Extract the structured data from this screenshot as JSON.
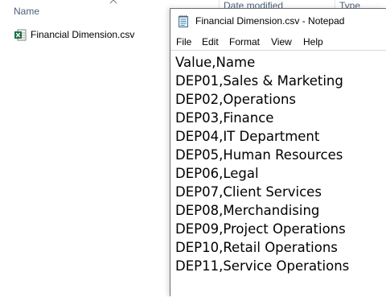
{
  "explorer": {
    "columns": {
      "name": "Name",
      "date_modified": "Date modified",
      "type": "Type"
    },
    "files": [
      {
        "name": "Financial Dimension.csv",
        "icon": "excel-csv-icon"
      }
    ]
  },
  "notepad": {
    "title": "Financial Dimension.csv - Notepad",
    "menu": [
      "File",
      "Edit",
      "Format",
      "View",
      "Help"
    ],
    "lines": [
      "Value,Name",
      "DEP01,Sales & Marketing",
      "DEP02,Operations",
      "DEP03,Finance",
      "DEP04,IT Department",
      "DEP05,Human Resources",
      "DEP06,Legal",
      "DEP07,Client Services",
      "DEP08,Merchandising",
      "DEP09,Project Operations",
      "DEP10,Retail Operations",
      "DEP11,Service Operations"
    ]
  },
  "colors": {
    "excel_green": "#1d6f42",
    "header_text": "#4c607a"
  }
}
